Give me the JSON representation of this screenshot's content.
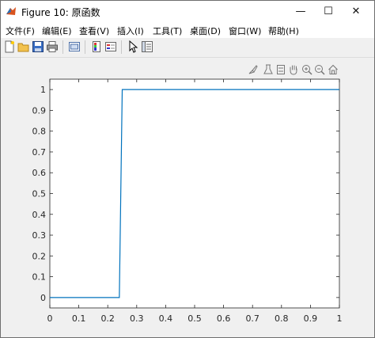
{
  "window": {
    "title": "Figure 10: 原函数",
    "minimize": "—",
    "maximize": "☐",
    "close": "✕"
  },
  "menu": [
    {
      "label": "文件(F)"
    },
    {
      "label": "编辑(E)"
    },
    {
      "label": "查看(V)"
    },
    {
      "label": "插入(I)"
    },
    {
      "label": "工具(T)"
    },
    {
      "label": "桌面(D)"
    },
    {
      "label": "窗口(W)"
    },
    {
      "label": "帮助(H)"
    }
  ],
  "toolbar": [
    "new-figure-icon",
    "open-icon",
    "save-icon",
    "print-icon",
    "link-plot-icon",
    "colorbar-icon",
    "legend-icon",
    "edit-plot-icon",
    "property-inspector-icon"
  ],
  "axes_toolbar": [
    "brush-icon",
    "data-tip-icon",
    "pan-icon",
    "zoom-in-icon",
    "zoom-out-icon",
    "home-icon"
  ],
  "chart_data": {
    "type": "line",
    "title": "",
    "xlabel": "",
    "ylabel": "",
    "xlim": [
      0,
      1
    ],
    "ylim": [
      -0.05,
      1.05
    ],
    "xticks": [
      "0",
      "0.1",
      "0.2",
      "0.3",
      "0.4",
      "0.5",
      "0.6",
      "0.7",
      "0.8",
      "0.9",
      "1"
    ],
    "yticks": [
      "0",
      "0.1",
      "0.2",
      "0.3",
      "0.4",
      "0.5",
      "0.6",
      "0.7",
      "0.8",
      "0.9",
      "1"
    ],
    "grid": false,
    "series": [
      {
        "color": "#0072BD",
        "x": [
          0,
          0.24,
          0.25,
          1
        ],
        "y": [
          0,
          0,
          1,
          1
        ]
      }
    ]
  }
}
